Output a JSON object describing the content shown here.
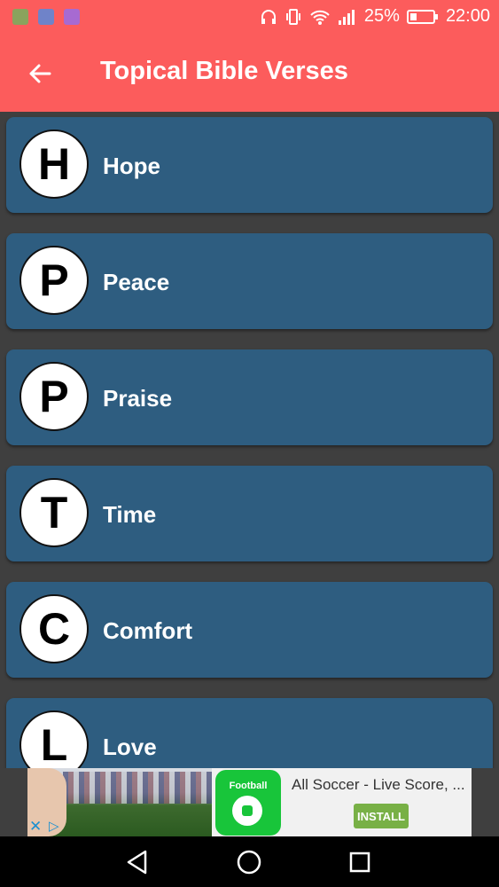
{
  "status_bar": {
    "battery_percent": "25%",
    "time": "22:00",
    "icons": [
      "android-app-icon",
      "dropbox-icon",
      "gallery-app-icon",
      "headphones-icon",
      "vibrate-icon",
      "wifi-icon",
      "signal-icon",
      "battery-icon"
    ]
  },
  "app_bar": {
    "title": "Topical Bible Verses",
    "back_icon": "arrow-left-icon"
  },
  "topics": [
    {
      "letter": "H",
      "label": "Hope"
    },
    {
      "letter": "P",
      "label": "Peace"
    },
    {
      "letter": "P",
      "label": "Praise"
    },
    {
      "letter": "T",
      "label": "Time"
    },
    {
      "letter": "C",
      "label": "Comfort"
    },
    {
      "letter": "L",
      "label": "Love"
    }
  ],
  "ad": {
    "icon_text": "Football",
    "title": "All Soccer - Live Score, ...",
    "install_label": "INSTALL",
    "close_icon": "close-icon",
    "adchoices_icon": "adchoices-icon"
  },
  "nav_bar": {
    "icons": [
      "back-triangle-icon",
      "home-circle-icon",
      "recents-square-icon"
    ]
  },
  "colors": {
    "accent": "#fc5c5c",
    "card": "#2e5d80",
    "background": "#3f3f3f"
  }
}
